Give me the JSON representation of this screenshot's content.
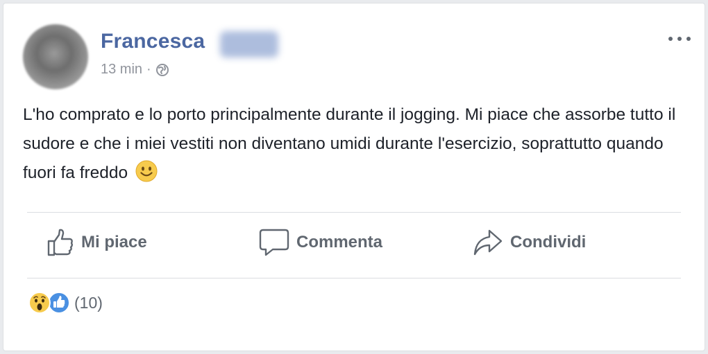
{
  "post": {
    "author_first_name": "Francesca",
    "timestamp": "13 min",
    "separator": "·",
    "audience_icon": "globe-icon",
    "text": "L'ho comprato e lo porto principalmente durante il jogging. Mi piace che assorbe tutto il sudore e che i miei vestiti non diventano umidi durante l'esercizio, soprattutto quando fuori fa freddo",
    "emoji": "slightly-smiling-face"
  },
  "actions": {
    "like_label": "Mi piace",
    "comment_label": "Commenta",
    "share_label": "Condividi"
  },
  "reactions": {
    "types": [
      "wow",
      "like"
    ],
    "count_label": "(10)"
  },
  "colors": {
    "author_name": "#4b67a1",
    "text": "#1d2129",
    "secondary_text": "#90949c",
    "action_text": "#606770",
    "like_blue": "#4a90e2",
    "emoji_yellow": "#f7cb4d"
  }
}
